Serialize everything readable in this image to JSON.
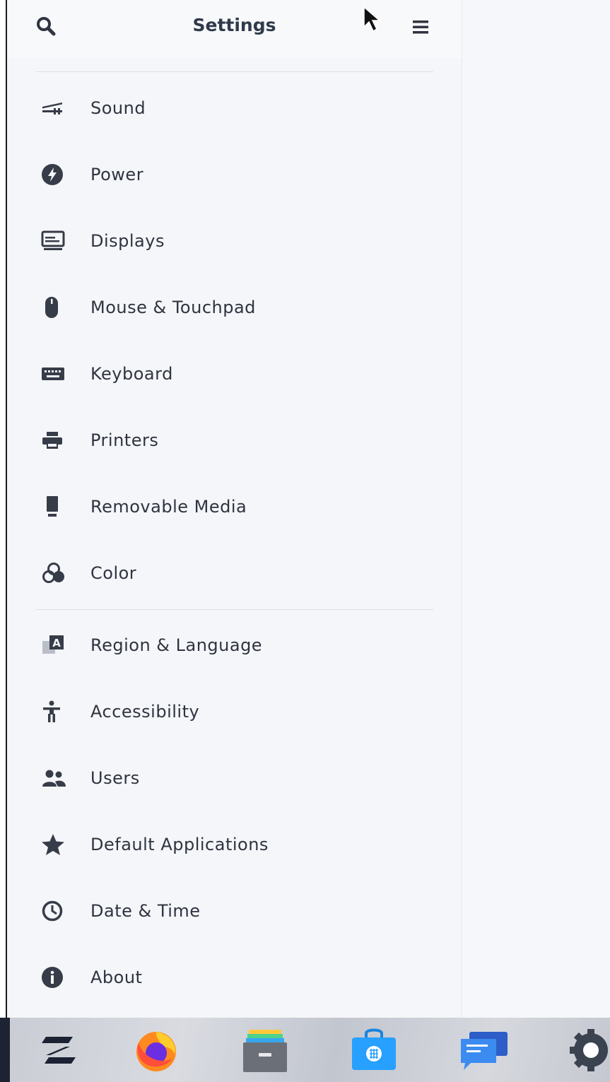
{
  "header": {
    "title": "Settings",
    "search_icon": "search-icon",
    "menu_icon": "menu-icon"
  },
  "sidebar": {
    "items": [
      {
        "label": "Sound",
        "icon": "sound-icon"
      },
      {
        "label": "Power",
        "icon": "power-icon"
      },
      {
        "label": "Displays",
        "icon": "display-icon"
      },
      {
        "label": "Mouse & Touchpad",
        "icon": "mouse-icon"
      },
      {
        "label": "Keyboard",
        "icon": "keyboard-icon"
      },
      {
        "label": "Printers",
        "icon": "printer-icon"
      },
      {
        "label": "Removable Media",
        "icon": "removable-media-icon"
      },
      {
        "label": "Color",
        "icon": "color-icon"
      },
      {
        "label": "Region & Language",
        "icon": "region-language-icon"
      },
      {
        "label": "Accessibility",
        "icon": "accessibility-icon"
      },
      {
        "label": "Users",
        "icon": "users-icon"
      },
      {
        "label": "Default Applications",
        "icon": "star-icon"
      },
      {
        "label": "Date & Time",
        "icon": "clock-icon"
      },
      {
        "label": "About",
        "icon": "info-icon"
      }
    ]
  },
  "taskbar": {
    "apps": [
      {
        "name": "zorin-menu",
        "icon": "zorin-logo-icon"
      },
      {
        "name": "firefox",
        "icon": "firefox-icon"
      },
      {
        "name": "files",
        "icon": "files-icon"
      },
      {
        "name": "software",
        "icon": "software-store-icon"
      },
      {
        "name": "messages",
        "icon": "chat-icon"
      },
      {
        "name": "settings",
        "icon": "gear-icon"
      }
    ]
  },
  "colors": {
    "sidebar_bg": "#f5f6f9",
    "text": "#2e3440",
    "icon": "#363c48",
    "divider": "#dcdfe6"
  }
}
